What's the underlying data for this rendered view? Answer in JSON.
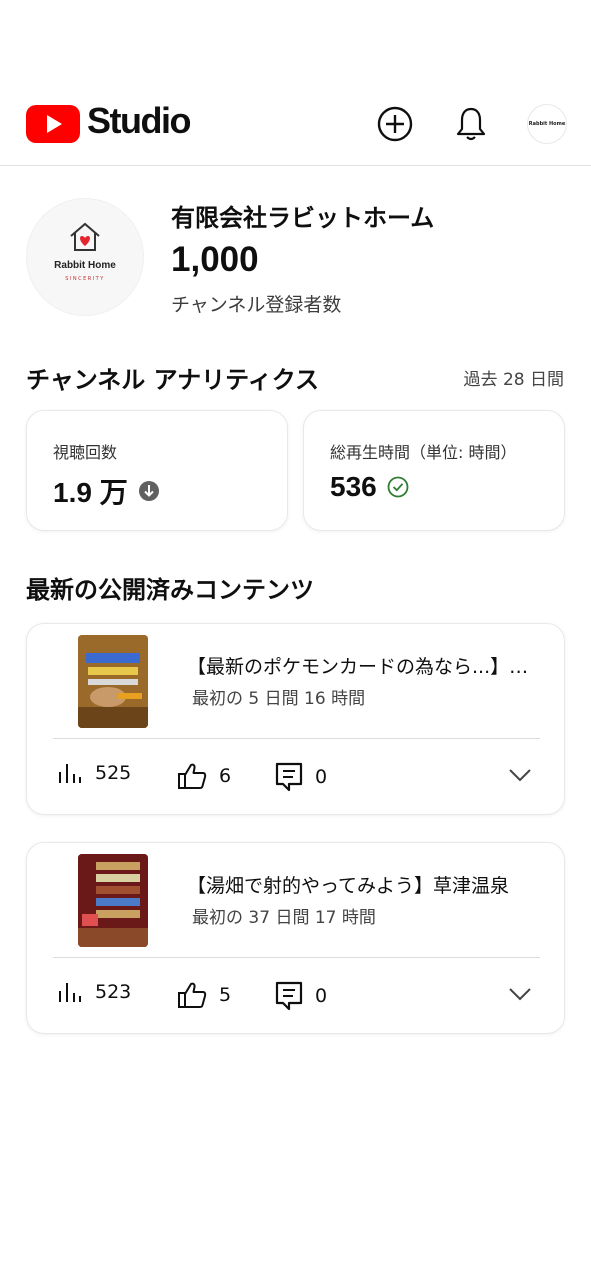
{
  "header": {
    "brand": "Studio",
    "create_icon": "plus-circle-icon",
    "notification_icon": "bell-icon",
    "avatar_text": "Rabbit Home"
  },
  "channel": {
    "name": "有限会社ラビットホーム",
    "subscriber_count": "1,000",
    "subscriber_label": "チャンネル登録者数",
    "avatar_brand": "Rabbit Home",
    "avatar_tagline": "SINCERITY"
  },
  "analytics": {
    "title": "チャンネル アナリティクス",
    "period": "過去 28 日間",
    "views": {
      "label": "視聴回数",
      "value": "1.9 万",
      "status_icon": "arrow-down-circle-icon"
    },
    "watch_time": {
      "label": "総再生時間（単位: 時間）",
      "value": "536",
      "status_icon": "check-circle-icon"
    }
  },
  "latest": {
    "title": "最新の公開済みコンテンツ",
    "videos": [
      {
        "title": "【最新のポケモンカードの為なら...】ポケカ",
        "meta": "最初の 5 日間 16 時間",
        "views": "525",
        "likes": "6",
        "comments": "0"
      },
      {
        "title": "【湯畑で射的やってみよう】草津温泉",
        "meta": "最初の 37 日間 17 時間",
        "views": "523",
        "likes": "5",
        "comments": "0"
      }
    ]
  },
  "colors": {
    "brand_red": "#ff0000",
    "text": "#0f0f0f",
    "muted": "#444444",
    "check_green": "#2e7d32"
  }
}
